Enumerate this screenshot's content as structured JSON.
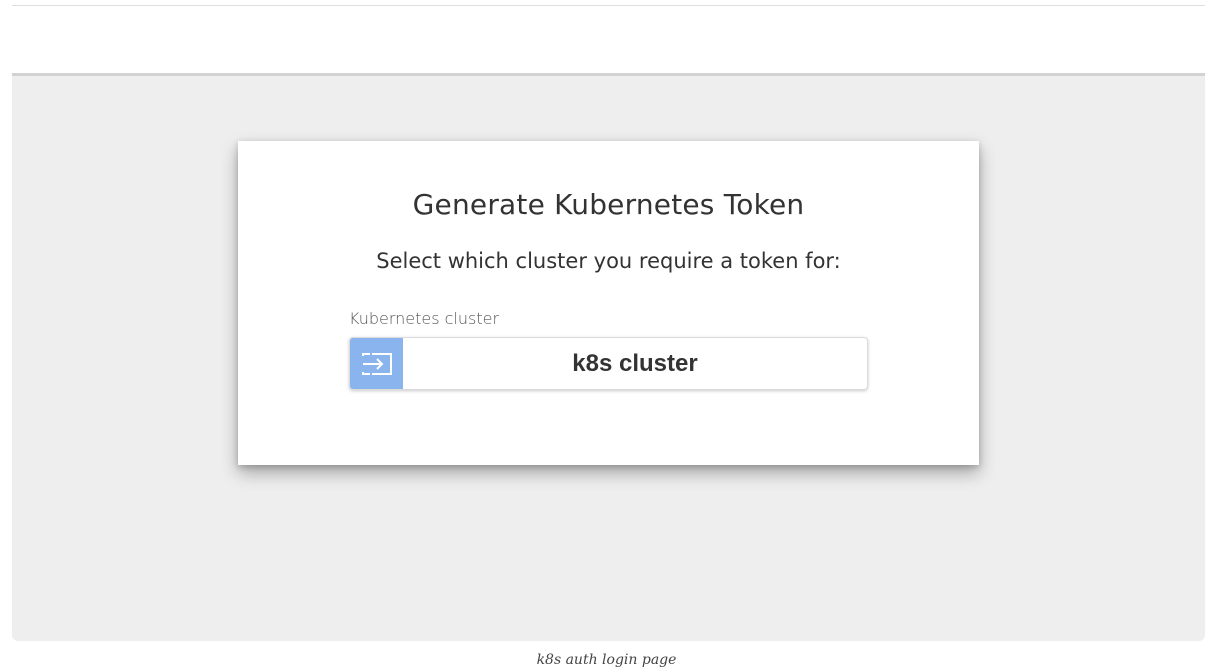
{
  "card": {
    "title": "Generate Kubernetes Token",
    "subtitle": "Select which cluster you require a token for:",
    "field_label": "Kubernetes cluster",
    "cluster_button": {
      "label": "k8s cluster",
      "icon": "sign-in-icon",
      "icon_color": "#8ab4ee"
    }
  },
  "caption": "k8s auth login page",
  "colors": {
    "frame_background": "#eeeeee",
    "card_background": "#ffffff",
    "accent": "#8ab4ee",
    "text": "#333333"
  }
}
